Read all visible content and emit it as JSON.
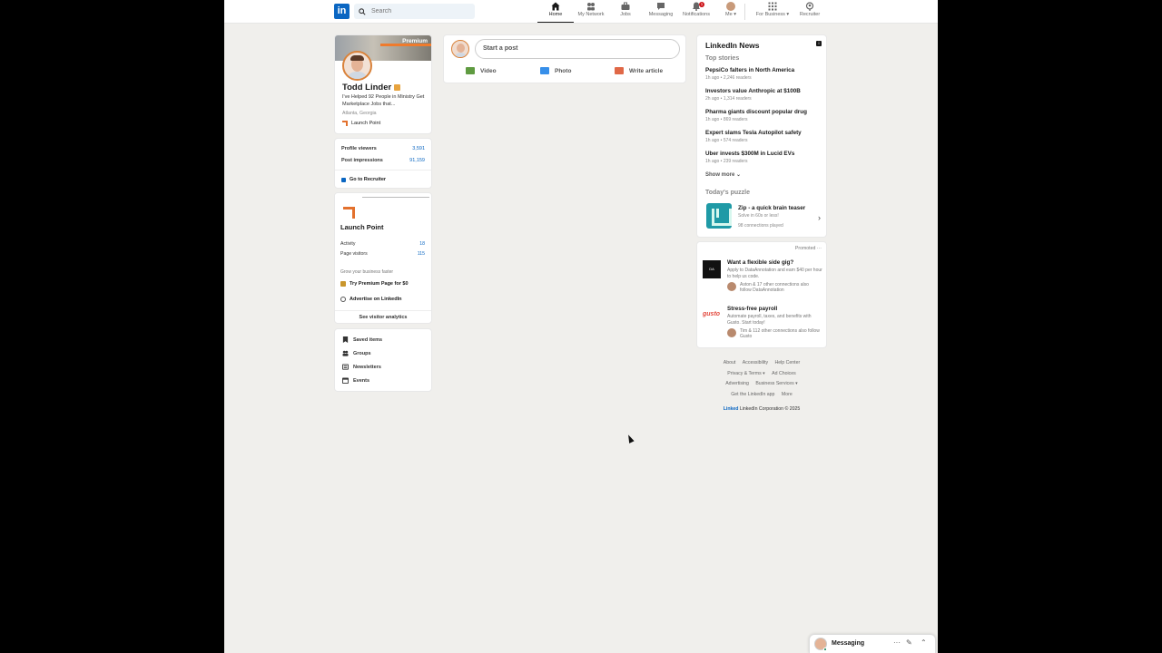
{
  "nav": {
    "search_placeholder": "Search",
    "items": [
      {
        "label": "Home",
        "icon": "home-icon"
      },
      {
        "label": "My Network",
        "icon": "network-icon"
      },
      {
        "label": "Jobs",
        "icon": "briefcase-icon"
      },
      {
        "label": "Messaging",
        "icon": "chat-icon"
      },
      {
        "label": "Notifications",
        "icon": "bell-icon",
        "badge": "1"
      },
      {
        "label": "Me ▾",
        "icon": "avatar"
      },
      {
        "label": "For Business ▾",
        "icon": "grid-icon"
      },
      {
        "label": "Recruiter",
        "icon": "recruiter-icon"
      }
    ],
    "accent": "#0a66c2"
  },
  "profile": {
    "banner_text": "Premium",
    "name": "Todd Linder",
    "headline": "I've Helped 92 People in Ministry Get Marketplace Jobs that...",
    "location": "Atlanta, Georgia",
    "company": "Launch Point"
  },
  "stats": {
    "profile_viewers_label": "Profile viewers",
    "profile_viewers": "3,591",
    "post_impressions_label": "Post impressions",
    "post_impressions": "91,159",
    "recruiter_link": "Go to Recruiter"
  },
  "company_page": {
    "name": "Launch Point",
    "activity_label": "Activity",
    "activity": "18",
    "visitors_label": "Page visitors",
    "visitors": "115",
    "grow_text": "Grow your business faster",
    "premium_link": "Try Premium Page for $0",
    "advertise_link": "Advertise on LinkedIn",
    "analytics_link": "See visitor analytics"
  },
  "shortcuts": [
    {
      "label": "Saved items"
    },
    {
      "label": "Groups"
    },
    {
      "label": "Newsletters"
    },
    {
      "label": "Events"
    }
  ],
  "share": {
    "placeholder": "Start a post",
    "actions": [
      {
        "label": "Video",
        "color": "#5f9b41"
      },
      {
        "label": "Photo",
        "color": "#378fe9"
      },
      {
        "label": "Write article",
        "color": "#e06847"
      }
    ]
  },
  "news": {
    "title": "LinkedIn News",
    "top_stories": "Top stories",
    "stories": [
      {
        "headline": "PepsiCo falters in North America",
        "meta": "1h ago • 2,246 readers"
      },
      {
        "headline": "Investors value Anthropic at $100B",
        "meta": "2h ago • 1,314 readers"
      },
      {
        "headline": "Pharma giants discount popular drug",
        "meta": "1h ago • 869 readers"
      },
      {
        "headline": "Expert slams Tesla Autopilot safety",
        "meta": "1h ago • 574 readers"
      },
      {
        "headline": "Uber invests $300M in Lucid EVs",
        "meta": "1h ago • 239 readers"
      }
    ],
    "show_more": "Show more ⌄",
    "puzzle_title": "Today's puzzle",
    "puzzle_name": "Zip - a quick brain teaser",
    "puzzle_sub": "Solve in 60s or less!",
    "puzzle_played": "98 connections played"
  },
  "ads": {
    "promoted": "Promoted ···",
    "items": [
      {
        "logo": "DA",
        "headline": "Want a flexible side gig?",
        "desc": "Apply to DataAnnotation and earn $40 per hour to help us code.",
        "connections": "Aston & 17 other connections also follow DataAnnotation"
      },
      {
        "logo": "gusto",
        "headline": "Stress-free payroll",
        "desc": "Automate payroll, taxes, and benefits with Gusto. Start today!",
        "connections": "Tim & 112 other connections also follow Gusto"
      }
    ]
  },
  "footer": {
    "row1": [
      "About",
      "Accessibility",
      "Help Center"
    ],
    "row2": [
      "Privacy & Terms ▾",
      "Ad Choices"
    ],
    "row3": [
      "Advertising",
      "Business Services ▾"
    ],
    "row4": [
      "Get the LinkedIn app",
      "More"
    ],
    "brand": "Linked",
    "corp": "LinkedIn Corporation © 2025"
  },
  "messaging": {
    "label": "Messaging"
  }
}
